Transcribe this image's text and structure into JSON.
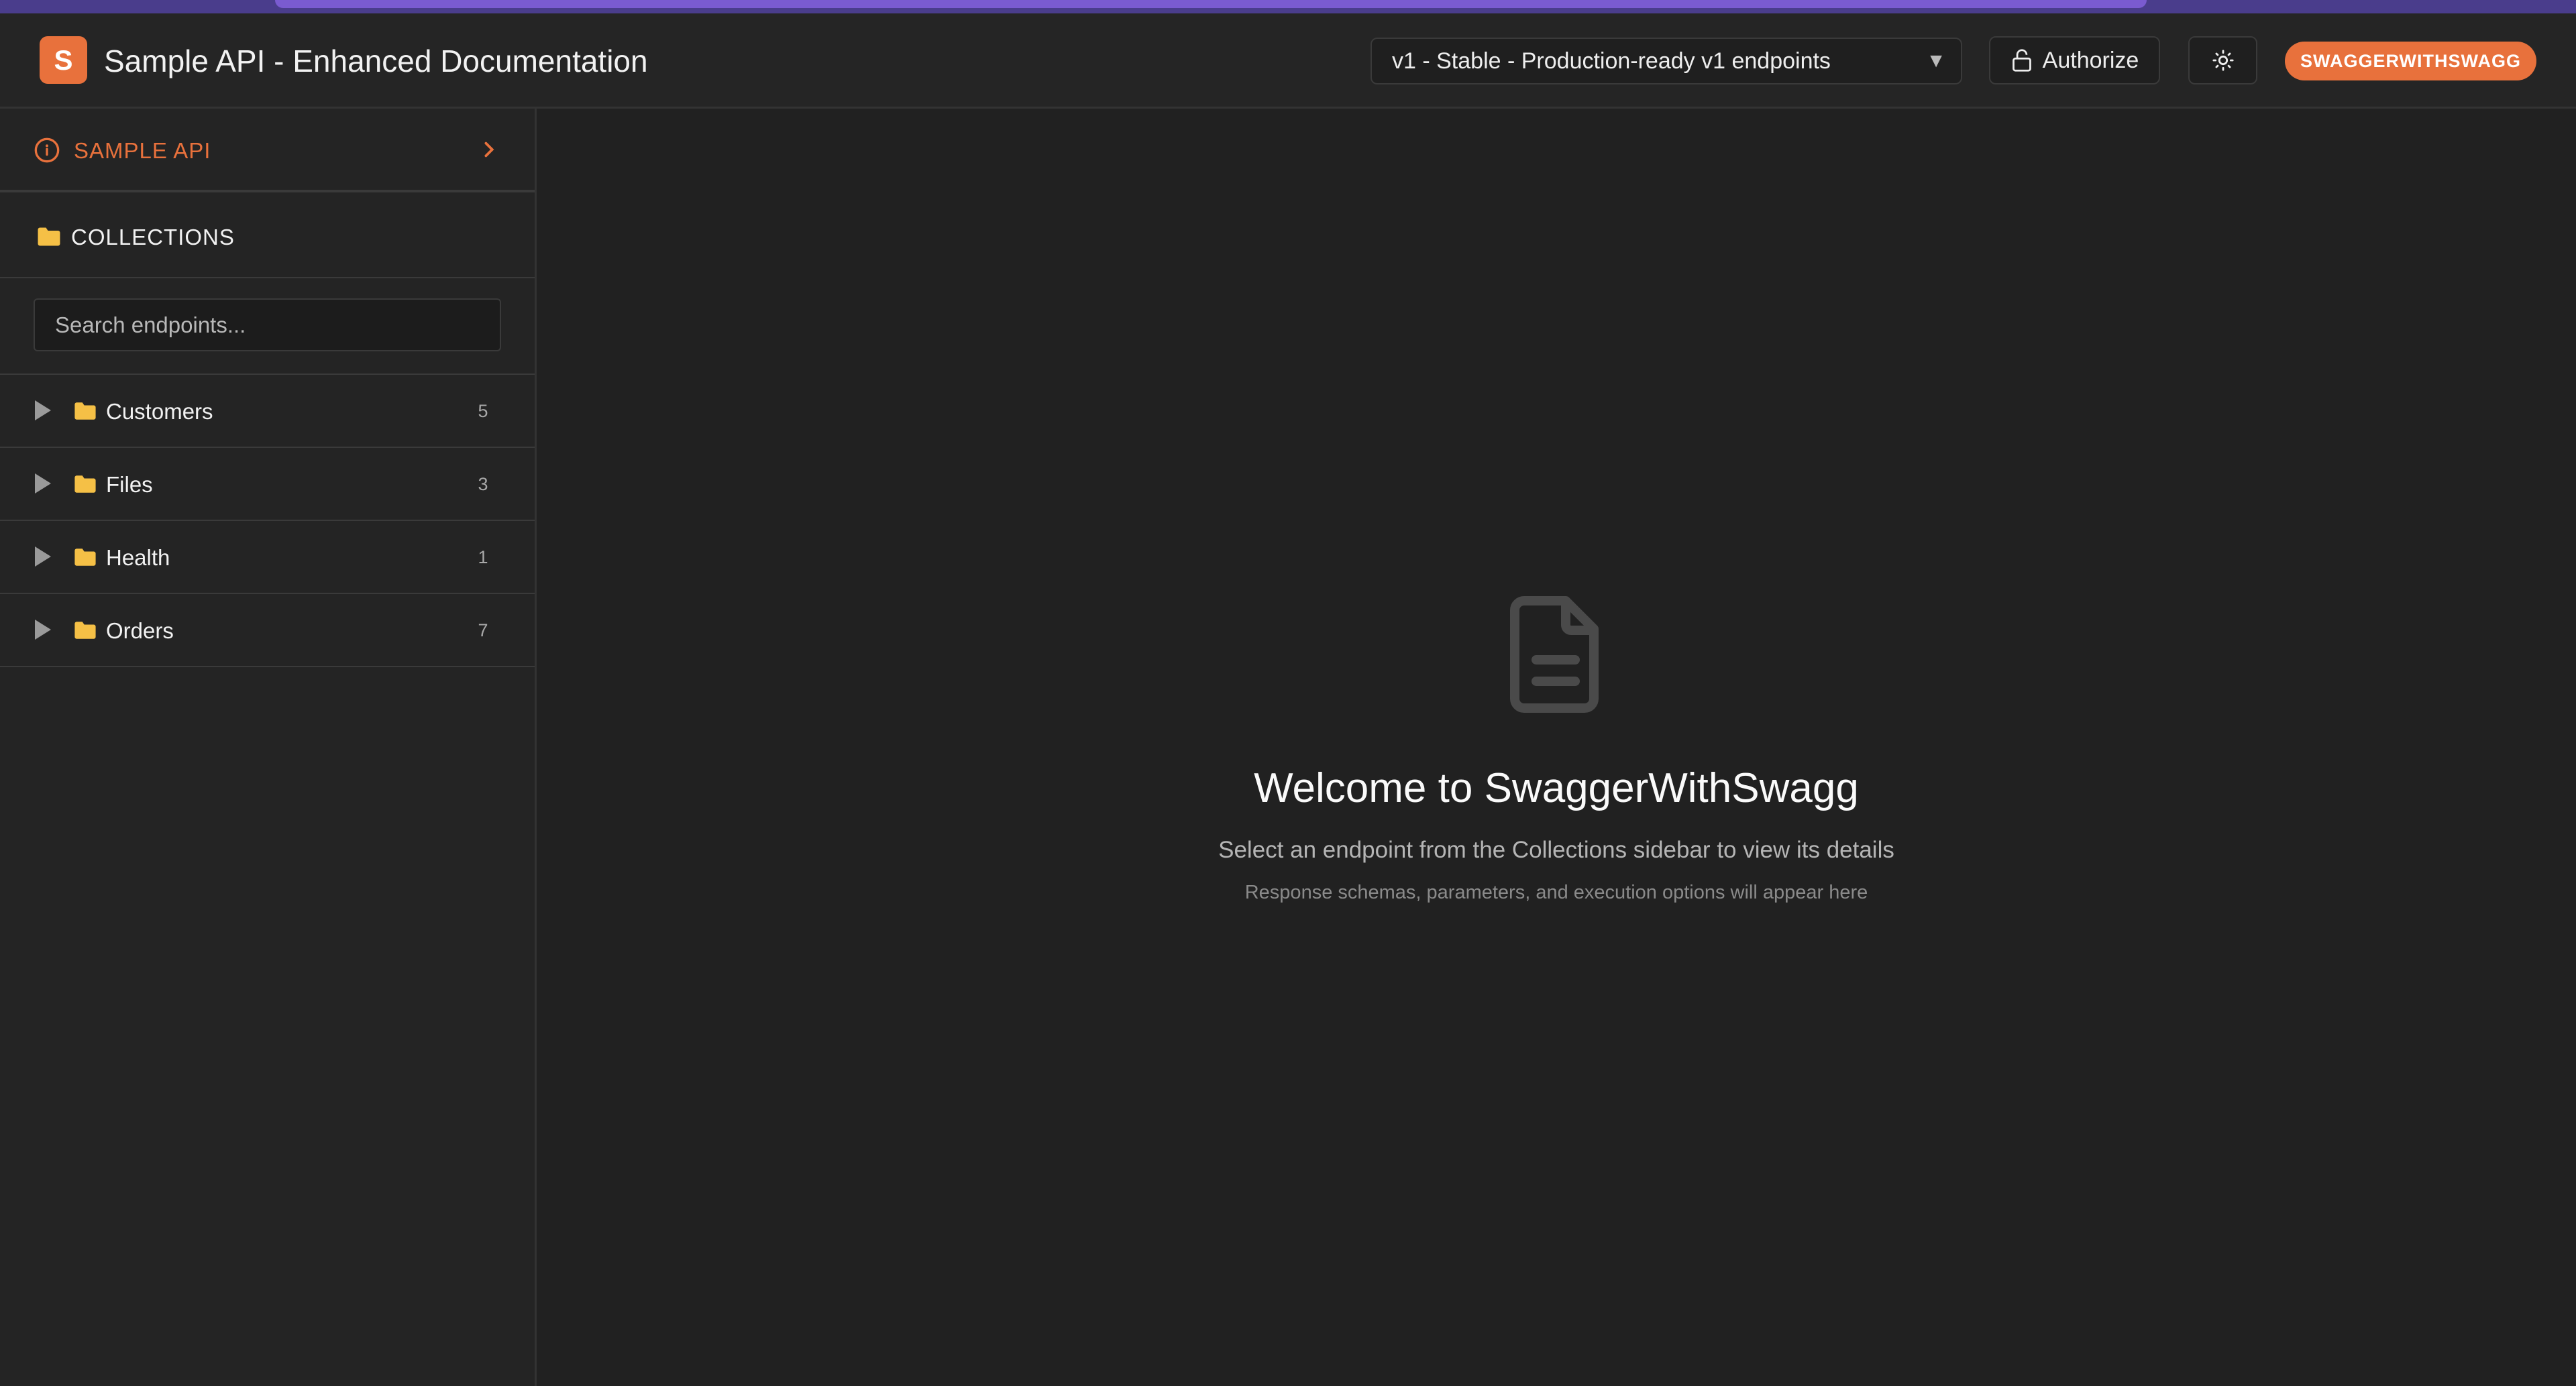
{
  "header": {
    "logo_letter": "S",
    "title": "Sample API - Enhanced Documentation",
    "version_select": "v1 - Stable - Production-ready v1 endpoints",
    "authorize_label": "Authorize",
    "brand_badge": "SWAGGERWITHSWAGG",
    "accent_color": "#e8713c"
  },
  "sidebar": {
    "api_label": "SAMPLE API",
    "collections_label": "COLLECTIONS",
    "search_placeholder": "Search endpoints...",
    "collections": [
      {
        "name": "Customers",
        "count": "5"
      },
      {
        "name": "Files",
        "count": "3"
      },
      {
        "name": "Health",
        "count": "1"
      },
      {
        "name": "Orders",
        "count": "7"
      }
    ]
  },
  "main": {
    "welcome_title": "Welcome to SwaggerWithSwagg",
    "welcome_subtitle": "Select an endpoint from the Collections sidebar to view its details",
    "welcome_hint": "Response schemas, parameters, and execution options will appear here"
  },
  "icons": {
    "logo": "logo-s-icon",
    "authorize": "lock-icon",
    "theme": "sun-icon",
    "api": "info-circle-icon",
    "collections": "folder-icon",
    "empty_state": "document-icon"
  }
}
